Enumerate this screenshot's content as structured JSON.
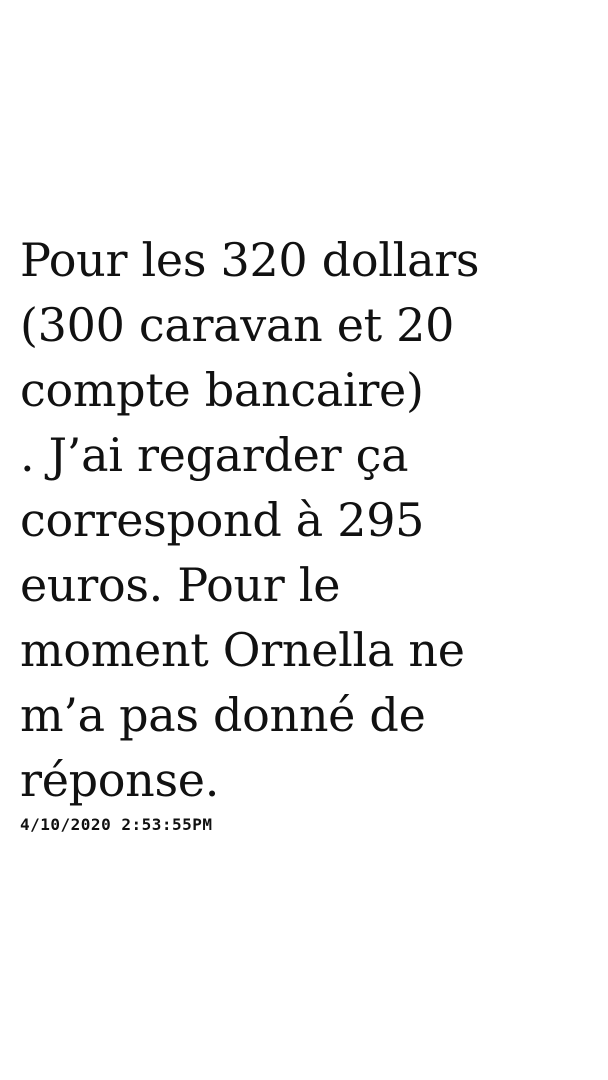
{
  "message": {
    "lines": [
      "Pour les 320 dollars",
      "(300 caravan et 20",
      "compte bancaire)",
      ". J’ai regarder ça",
      "correspond à 295",
      "euros. Pour le",
      "moment Ornella ne",
      "m’a pas donné de",
      "réponse."
    ],
    "timestamp": "4/10/2020 2:53:55PM"
  },
  "colors": {
    "background": "#ffffff",
    "text": "#111111"
  }
}
